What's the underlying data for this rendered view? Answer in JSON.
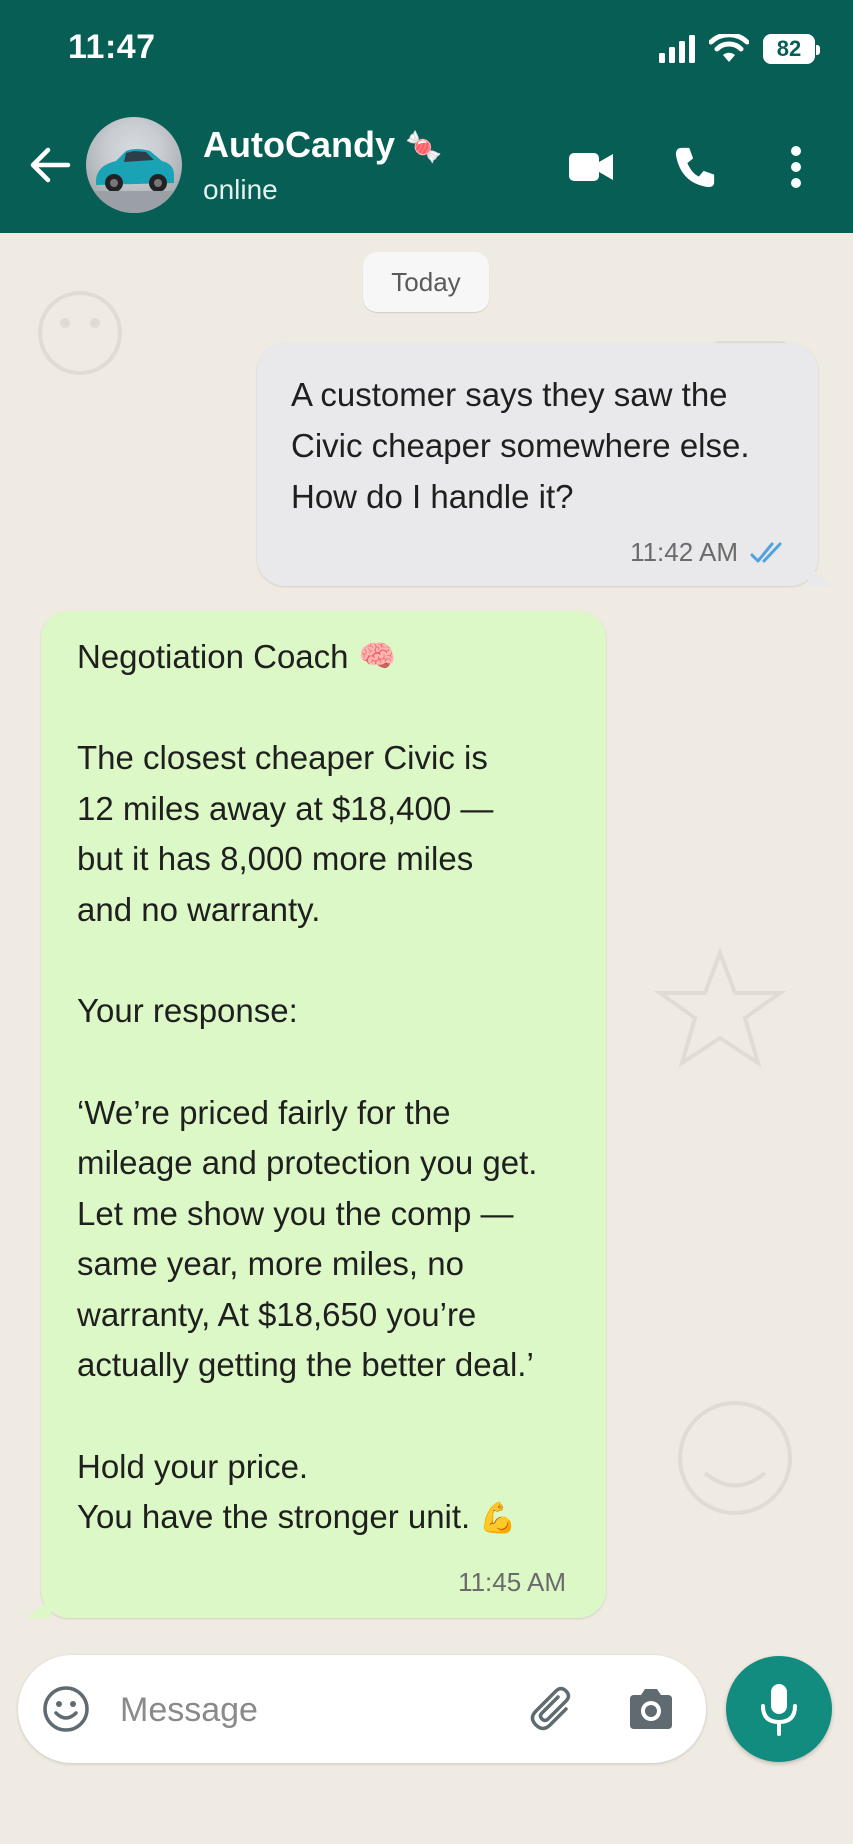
{
  "status_bar": {
    "time": "11:47",
    "battery": "82"
  },
  "header": {
    "contact_name": "AutoCandy",
    "contact_emoji": "🍬",
    "contact_status": "online",
    "icons": [
      "back-arrow-icon",
      "video-call-icon",
      "phone-icon",
      "more-options-icon"
    ]
  },
  "chat": {
    "date_label": "Today",
    "outgoing": {
      "text": "A customer says they saw the\nCivic cheaper somewhere else.\nHow do I handle it?",
      "time": "11:42 AM",
      "status_icon": "double-check-read-icon"
    },
    "incoming": {
      "title": "Negotiation Coach",
      "title_emoji": "🧠",
      "paragraph1": "The closest cheaper Civic is\n12 miles away at $18,400 —\nbut it has 8,000 more miles\nand no warranty.",
      "paragraph2": "Your response:",
      "paragraph3": "‘We’re priced fairly for the\nmileage and protection you get.\nLet me show you the comp —\nsame year, more miles, no\nwarranty, At $18,650 you’re\nactually getting the better deal.’",
      "paragraph4": "Hold your price.\nYou have the stronger unit.",
      "closing_emoji": "💪",
      "time": "11:45 AM"
    }
  },
  "composer": {
    "placeholder": "Message",
    "icons": [
      "emoji-icon",
      "paperclip-icon",
      "camera-icon",
      "microphone-icon"
    ]
  },
  "colors": {
    "header": "#075e54",
    "incoming_bubble": "#dcf8c6",
    "outgoing_bubble": "#e9e9eb",
    "mic_button": "#128c7e",
    "read_ticks": "#4fa3e0"
  }
}
